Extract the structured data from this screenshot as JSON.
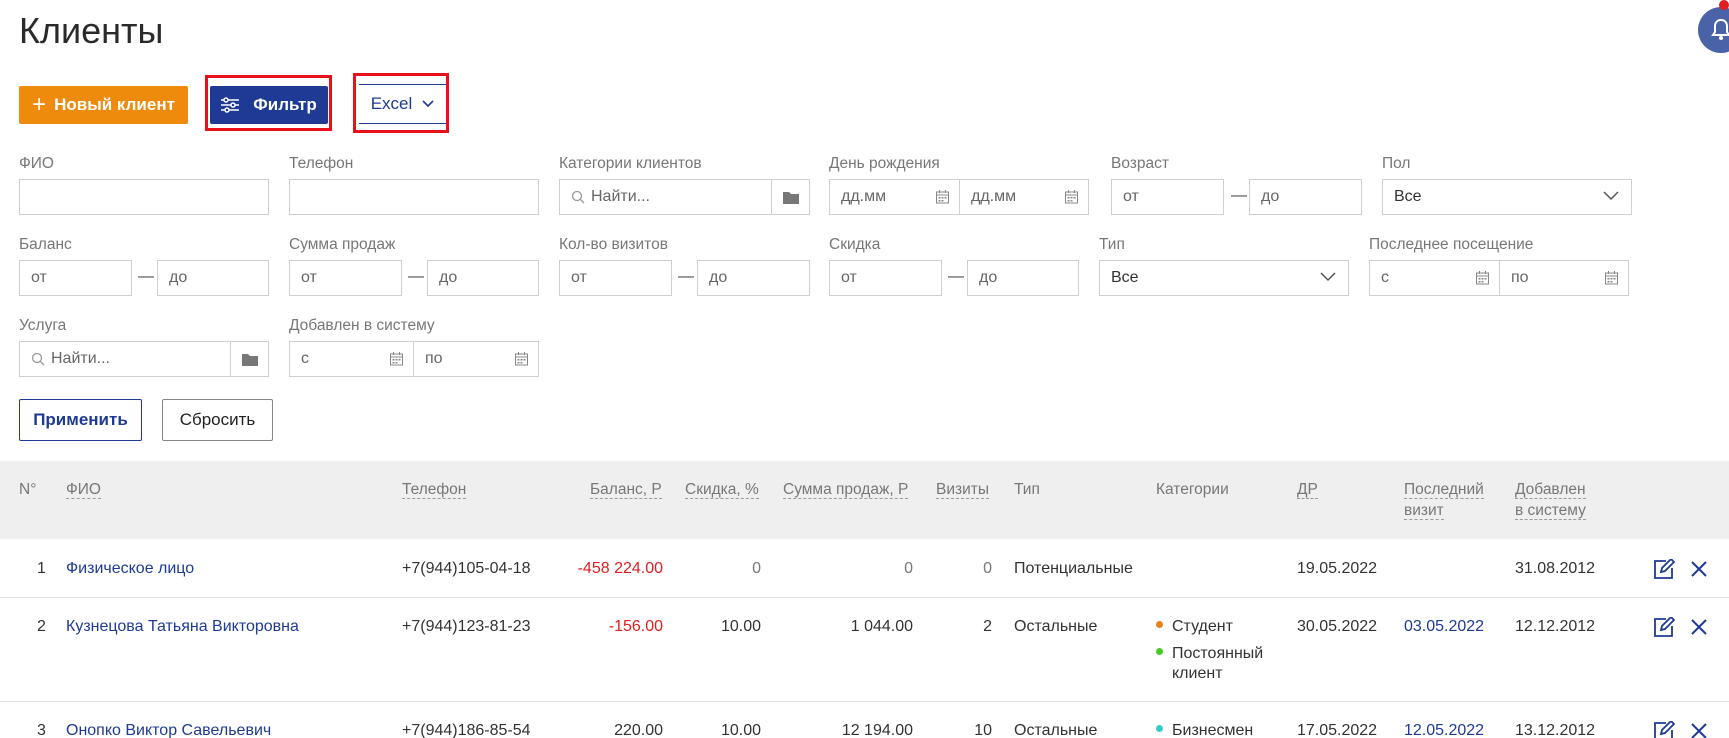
{
  "title": "Клиенты",
  "toolbar": {
    "new_client": "Новый клиент",
    "filter": "Фильтр",
    "excel": "Excel"
  },
  "filters": {
    "fio_label": "ФИО",
    "phone_label": "Телефон",
    "categories_label": "Категории клиентов",
    "categories_placeholder": "Найти...",
    "birthday_label": "День рождения",
    "birthday_from": "дд.мм",
    "birthday_to": "дд.мм",
    "age_label": "Возраст",
    "from": "от",
    "to": "до",
    "gender_label": "Пол",
    "gender_value": "Все",
    "balance_label": "Баланс",
    "sales_label": "Сумма продаж",
    "visits_label": "Кол-во визитов",
    "discount_label": "Скидка",
    "type_label": "Тип",
    "type_value": "Все",
    "last_visit_label": "Последнее посещение",
    "date_from": "с",
    "date_to": "по",
    "service_label": "Услуга",
    "service_placeholder": "Найти...",
    "added_label": "Добавлен в систему",
    "apply": "Применить",
    "reset": "Сбросить"
  },
  "table": {
    "headers": {
      "num": "N°",
      "fio": "ФИО",
      "phone": "Телефон",
      "balance": "Баланс, Р",
      "discount": "Скидка, %",
      "sales": "Сумма продаж, Р",
      "visits": "Визиты",
      "type": "Тип",
      "categories": "Категории",
      "dob": "ДР",
      "last_visit_1": "Последний",
      "last_visit_2": "визит",
      "added_1": "Добавлен",
      "added_2": "в систему"
    },
    "rows": [
      {
        "num": "1",
        "fio": "Физическое лицо",
        "phone": "+7(944)105-04-18",
        "balance": "-458 224.00",
        "discount": "0",
        "sales": "0",
        "visits": "0",
        "type": "Потенциальные",
        "dob": "19.05.2022",
        "last_visit": "",
        "added": "31.08.2012"
      },
      {
        "num": "2",
        "fio": "Кузнецова Татьяна Викторовна",
        "phone": "+7(944)123-81-23",
        "balance": "-156.00",
        "discount": "10.00",
        "sales": "1 044.00",
        "visits": "2",
        "type": "Остальные",
        "cat1": "Студент",
        "cat2a": "Постоянный",
        "cat2b": "клиент",
        "dob": "30.05.2022",
        "last_visit": "03.05.2022",
        "added": "12.12.2012"
      },
      {
        "num": "3",
        "fio": "Онопко Виктор Савельевич",
        "phone": "+7(944)186-85-54",
        "balance": "220.00",
        "discount": "10.00",
        "sales": "12 194.00",
        "visits": "10",
        "type": "Остальные",
        "cat1": "Бизнесмен",
        "dob": "17.05.2022",
        "last_visit": "12.05.2022",
        "added": "13.12.2012"
      }
    ],
    "category_colors": {
      "student": "#e8801a",
      "regular": "#44cc22",
      "business": "#33cccc"
    }
  }
}
